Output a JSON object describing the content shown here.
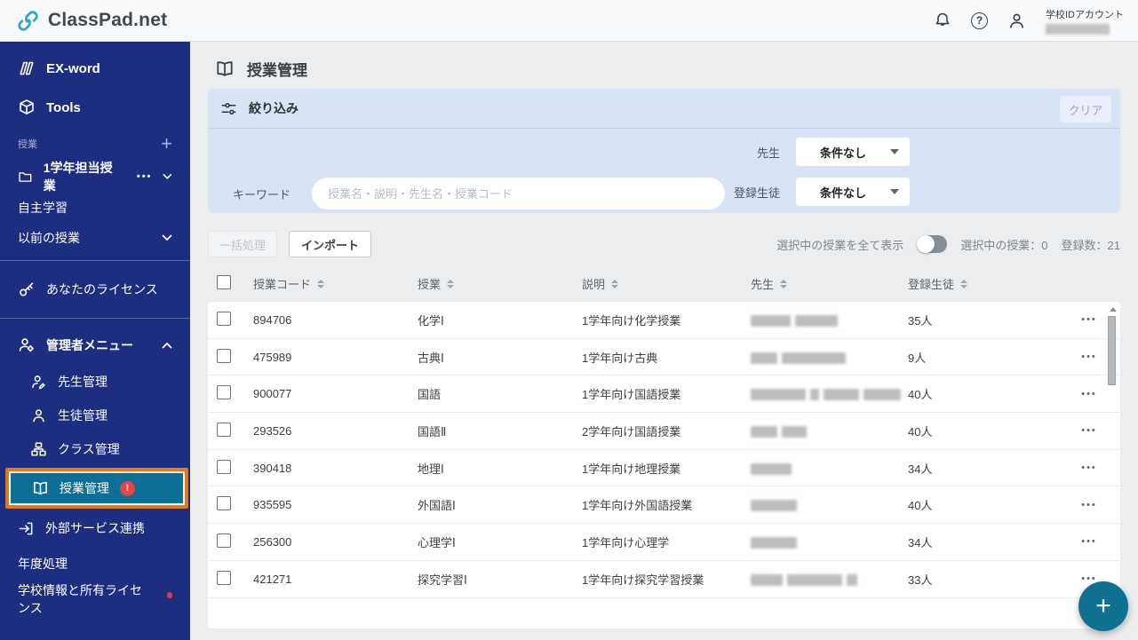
{
  "topbar": {
    "logo_text": "ClassPad.net",
    "account_type_label": "学校IDアカウント"
  },
  "icons": {
    "plus": "+",
    "help": "?",
    "alert": "!",
    "more": "•••"
  },
  "sidebar": {
    "ex_word": "EX-word",
    "tools": "Tools",
    "section_label": "授業",
    "class_folder": "1学年担当授業",
    "self_study": "自主学習",
    "previous_classes": "以前の授業",
    "your_license": "あなたのライセンス",
    "admin_menu": "管理者メニュー",
    "teacher_mgmt": "先生管理",
    "student_mgmt": "生徒管理",
    "class_mgmt": "クラス管理",
    "lesson_mgmt": "授業管理",
    "external_services": "外部サービス連携",
    "year_processing": "年度処理",
    "school_info": "学校情報と所有ライセンス"
  },
  "page": {
    "title": "授業管理"
  },
  "filter": {
    "title": "絞り込み",
    "clear_label": "クリア",
    "keyword_label": "キーワード",
    "keyword_placeholder": "授業名・説明・先生名・授業コード",
    "teacher_label": "先生",
    "teacher_value": "条件なし",
    "students_label": "登録生徒",
    "students_value": "条件なし"
  },
  "toolbar": {
    "bulk_label": "一括処理",
    "import_label": "インポート",
    "show_selected_label": "選択中の授業を全て表示",
    "selected_count_label": "選択中の授業：0",
    "total_count_label": "登録数：21"
  },
  "table": {
    "headers": {
      "code": "授業コード",
      "name": "授業",
      "description": "説明",
      "teacher": "先生",
      "students": "登録生徒"
    },
    "rows": [
      {
        "code": "894706",
        "name": "化学Ⅰ",
        "description": "1学年向け化学授業",
        "students": "35人",
        "blur": [
          45,
          48
        ]
      },
      {
        "code": "475989",
        "name": "古典Ⅰ",
        "description": "1学年向け古典",
        "students": "9人",
        "blur": [
          30,
          72
        ]
      },
      {
        "code": "900077",
        "name": "国語",
        "description": "1学年向け国語授業",
        "students": "40人",
        "blur": [
          62,
          10,
          40,
          42
        ]
      },
      {
        "code": "293526",
        "name": "国語Ⅱ",
        "description": "2学年向け国語授業",
        "students": "40人",
        "blur": [
          30,
          28
        ]
      },
      {
        "code": "390418",
        "name": "地理Ⅰ",
        "description": "1学年向け地理授業",
        "students": "34人",
        "blur": [
          46
        ]
      },
      {
        "code": "935595",
        "name": "外国語Ⅰ",
        "description": "1学年向け外国語授業",
        "students": "40人",
        "blur": [
          52
        ]
      },
      {
        "code": "256300",
        "name": "心理学Ⅰ",
        "description": "1学年向け心理学",
        "students": "34人",
        "blur": [
          52
        ]
      },
      {
        "code": "421271",
        "name": "探究学習Ⅰ",
        "description": "1学年向け探究学習授業",
        "students": "33人",
        "blur": [
          36,
          62,
          12
        ]
      }
    ]
  },
  "colors": {
    "sidebar": "#1d2d80",
    "active_item_bg": "#0d6f95",
    "highlight_border": "#e2791d",
    "filter_panel": "#d9e3f6",
    "fab": "#0e7191",
    "logo_accent": "#2aa7bf",
    "alert_red": "#e24646"
  }
}
